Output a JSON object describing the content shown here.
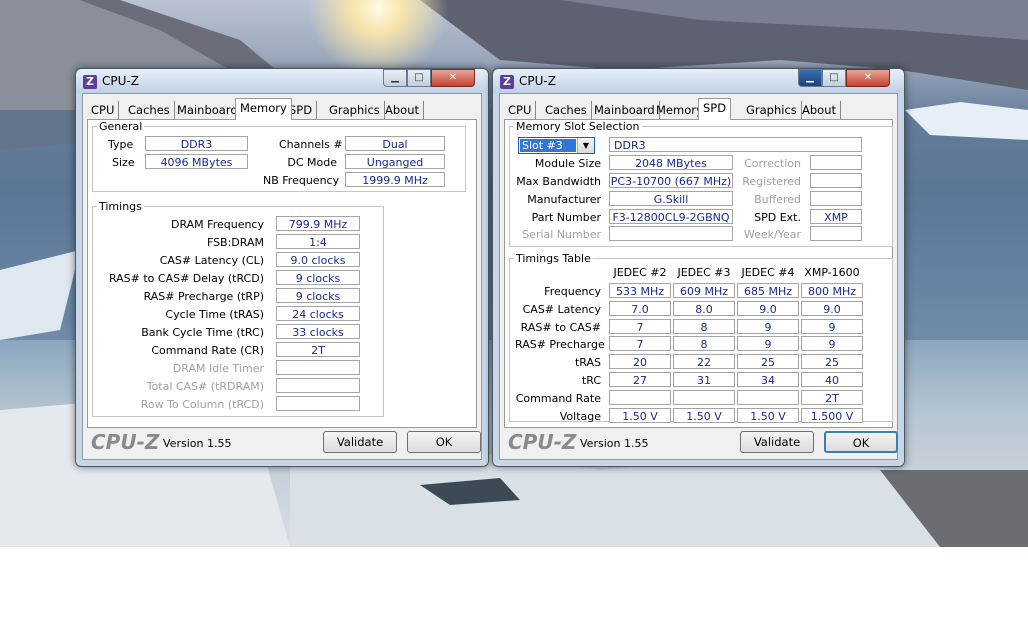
{
  "left_window": {
    "title": "CPU-Z",
    "icon_letter": "Z",
    "tabs": [
      "CPU",
      "Caches",
      "Mainboard",
      "Memory",
      "SPD",
      "Graphics",
      "About"
    ],
    "selected_tab": "Memory",
    "general": {
      "legend": "General",
      "type_label": "Type",
      "type_value": "DDR3",
      "size_label": "Size",
      "size_value": "4096 MBytes",
      "channels_label": "Channels #",
      "channels_value": "Dual",
      "dcmode_label": "DC Mode",
      "dcmode_value": "Unganged",
      "nbfreq_label": "NB Frequency",
      "nbfreq_value": "1999.9 MHz"
    },
    "timings": {
      "legend": "Timings",
      "rows": [
        {
          "label": "DRAM Frequency",
          "value": "799.9 MHz"
        },
        {
          "label": "FSB:DRAM",
          "value": "1:4"
        },
        {
          "label": "CAS# Latency (CL)",
          "value": "9.0 clocks"
        },
        {
          "label": "RAS# to CAS# Delay (tRCD)",
          "value": "9 clocks"
        },
        {
          "label": "RAS# Precharge (tRP)",
          "value": "9 clocks"
        },
        {
          "label": "Cycle Time (tRAS)",
          "value": "24 clocks"
        },
        {
          "label": "Bank Cycle Time (tRC)",
          "value": "33 clocks"
        },
        {
          "label": "Command Rate (CR)",
          "value": "2T"
        },
        {
          "label": "DRAM Idle Timer",
          "value": ""
        },
        {
          "label": "Total CAS# (tRDRAM)",
          "value": ""
        },
        {
          "label": "Row To Column (tRCD)",
          "value": ""
        }
      ]
    },
    "footer": {
      "brand": "CPU-Z",
      "version": "Version 1.55",
      "validate": "Validate",
      "ok": "OK"
    }
  },
  "right_window": {
    "title": "CPU-Z",
    "icon_letter": "Z",
    "tabs": [
      "CPU",
      "Caches",
      "Mainboard",
      "Memory",
      "SPD",
      "Graphics",
      "About"
    ],
    "selected_tab": "SPD",
    "slot": {
      "legend": "Memory Slot Selection",
      "selected": "Slot #3",
      "mem_type": "DDR3",
      "module_size_label": "Module Size",
      "module_size": "2048 MBytes",
      "max_bw_label": "Max Bandwidth",
      "max_bw": "PC3-10700 (667 MHz)",
      "manufacturer_label": "Manufacturer",
      "manufacturer": "G.Skill",
      "part_label": "Part Number",
      "part": "F3-12800CL9-2GBNQ",
      "serial_label": "Serial Number",
      "serial": "",
      "correction_label": "Correction",
      "correction": "",
      "registered_label": "Registered",
      "registered": "",
      "buffered_label": "Buffered",
      "buffered": "",
      "spdext_label": "SPD Ext.",
      "spdext": "XMP",
      "weekyear_label": "Week/Year",
      "weekyear": ""
    },
    "timings_table": {
      "legend": "Timings Table",
      "columns": [
        "JEDEC #2",
        "JEDEC #3",
        "JEDEC #4",
        "XMP-1600"
      ],
      "rows": [
        {
          "label": "Frequency",
          "values": [
            "533 MHz",
            "609 MHz",
            "685 MHz",
            "800 MHz"
          ]
        },
        {
          "label": "CAS# Latency",
          "values": [
            "7.0",
            "8.0",
            "9.0",
            "9.0"
          ]
        },
        {
          "label": "RAS# to CAS#",
          "values": [
            "7",
            "8",
            "9",
            "9"
          ]
        },
        {
          "label": "RAS# Precharge",
          "values": [
            "7",
            "8",
            "9",
            "9"
          ]
        },
        {
          "label": "tRAS",
          "values": [
            "20",
            "22",
            "25",
            "25"
          ]
        },
        {
          "label": "tRC",
          "values": [
            "27",
            "31",
            "34",
            "40"
          ]
        },
        {
          "label": "Command Rate",
          "values": [
            "",
            "",
            "",
            "2T"
          ]
        },
        {
          "label": "Voltage",
          "values": [
            "1.50 V",
            "1.50 V",
            "1.50 V",
            "1.500 V"
          ]
        }
      ]
    },
    "footer": {
      "brand": "CPU-Z",
      "version": "Version 1.55",
      "validate": "Validate",
      "ok": "OK"
    }
  },
  "colors": {
    "value_text": "#1a2a8c",
    "dim_text": "#a0a0a0",
    "selection": "#3377d6"
  }
}
